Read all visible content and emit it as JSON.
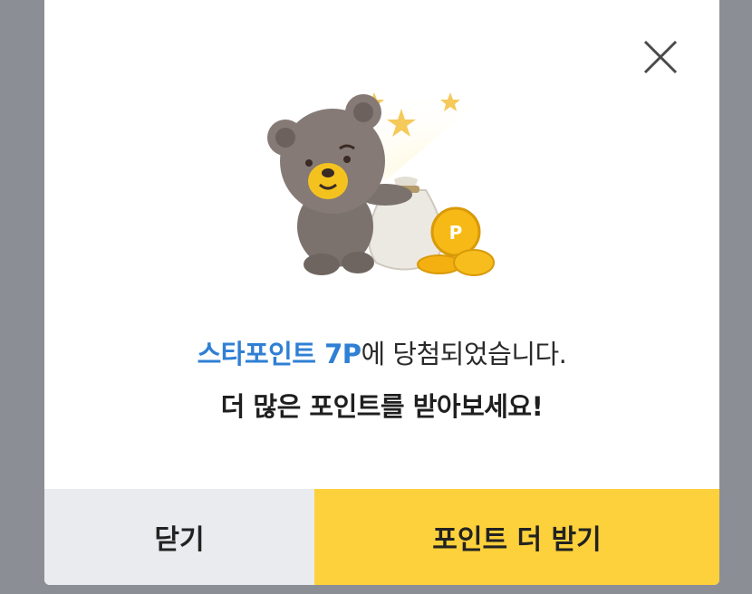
{
  "dialog": {
    "message_highlight": "스타포인트 7P",
    "message_rest": "에 당첨되었습니다.",
    "message_line2": "더 많은 포인트를 받아보세요!"
  },
  "buttons": {
    "close_label": "닫기",
    "get_more_label": "포인트 더 받기"
  },
  "icons": {
    "close": "close-x-icon",
    "illustration": "bear-with-point-bag"
  },
  "colors": {
    "highlight": "#2f7fd4",
    "primary_button": "#fdd13b",
    "secondary_button": "#e9ebee"
  }
}
